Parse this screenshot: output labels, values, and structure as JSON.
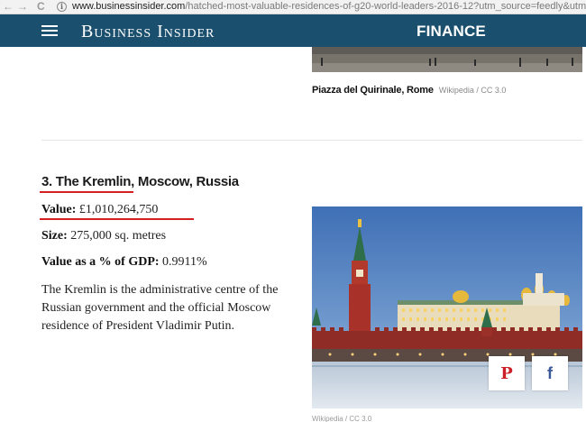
{
  "browser": {
    "url_host": "www.businessinsider.com",
    "url_path": "/hatched-most-valuable-residences-of-g20-world-leaders-2016-12?utm_source=feedly&utm_me",
    "back_glyph": "←",
    "forward_glyph": "→",
    "refresh_glyph": "C",
    "info_glyph": "i"
  },
  "header": {
    "brand": "Business Insider",
    "section": "FINANCE",
    "background": "#1b4f6e"
  },
  "previous_slide": {
    "caption_place": "Piazza del Quirinale, Rome",
    "caption_credit": "Wikipedia / CC 3.0"
  },
  "slide": {
    "title": "3. The Kremlin, Moscow, Russia",
    "value_label": "Value:",
    "value": "£1,010,264,750",
    "size_label": "Size:",
    "size": "275,000 sq. metres",
    "gdp_label": "Value as a % of GDP:",
    "gdp": "0.9911%",
    "description": "The Kremlin is the administrative centre of the Russian government and the official Moscow residence of President Vladimir Putin.",
    "image_credit": "Wikipedia / CC 3.0",
    "highlight_color": "#d42020"
  },
  "share": {
    "pinterest_glyph": "P",
    "facebook_glyph": "f"
  }
}
